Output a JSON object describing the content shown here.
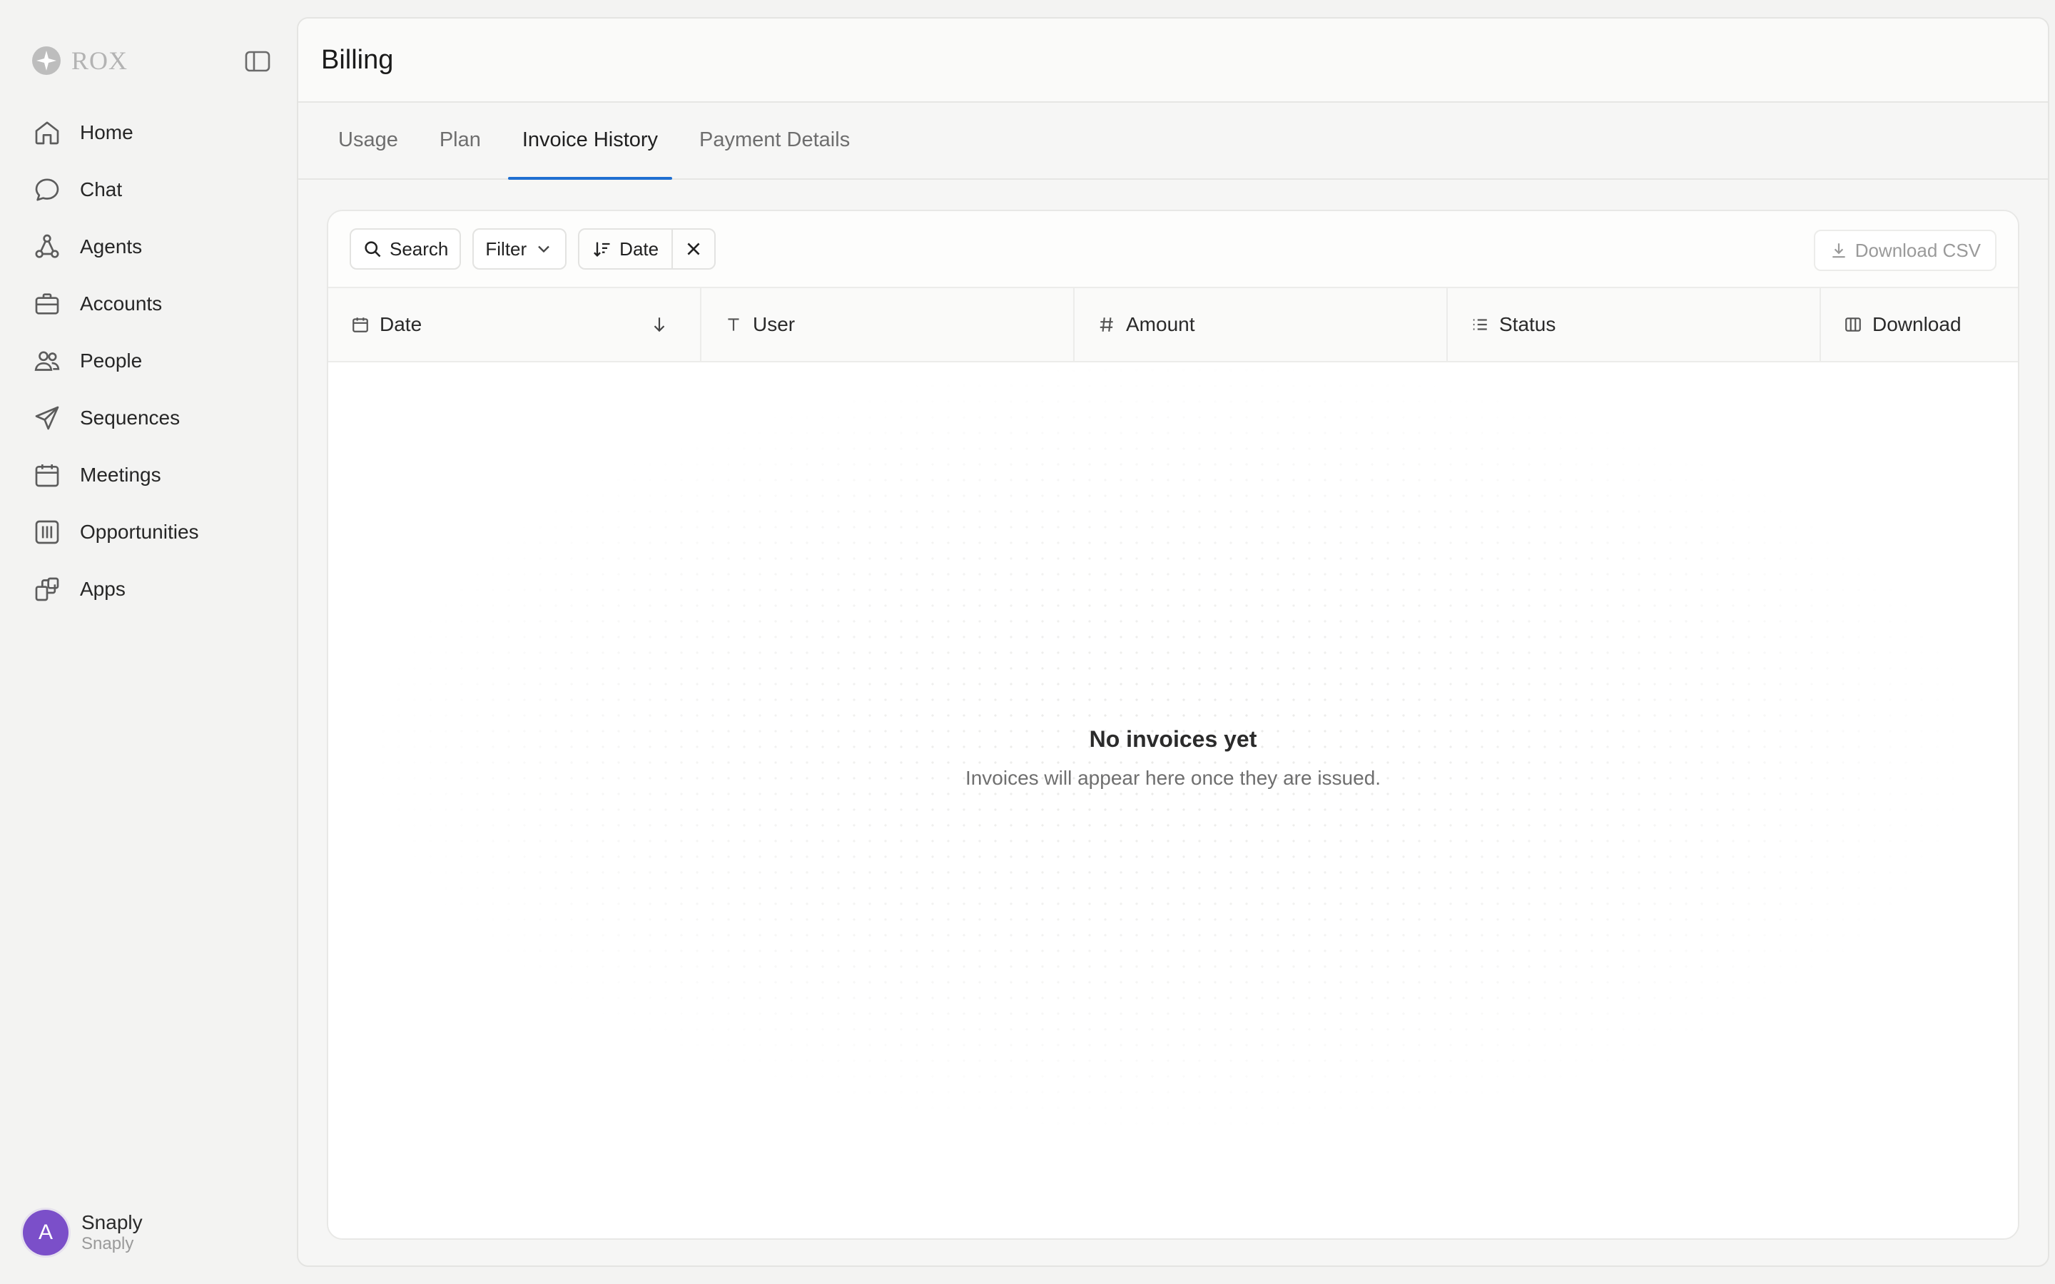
{
  "brand": {
    "name": "ROX"
  },
  "sidebar": {
    "items": [
      {
        "label": "Home",
        "icon": "home-icon"
      },
      {
        "label": "Chat",
        "icon": "chat-icon"
      },
      {
        "label": "Agents",
        "icon": "agents-icon"
      },
      {
        "label": "Accounts",
        "icon": "briefcase-icon"
      },
      {
        "label": "People",
        "icon": "people-icon"
      },
      {
        "label": "Sequences",
        "icon": "send-icon"
      },
      {
        "label": "Meetings",
        "icon": "calendar-icon"
      },
      {
        "label": "Opportunities",
        "icon": "columns-icon"
      },
      {
        "label": "Apps",
        "icon": "apps-icon"
      }
    ]
  },
  "user": {
    "initial": "A",
    "name": "Snaply",
    "org": "Snaply"
  },
  "header": {
    "title": "Billing"
  },
  "tabs": [
    {
      "label": "Usage",
      "active": false
    },
    {
      "label": "Plan",
      "active": false
    },
    {
      "label": "Invoice History",
      "active": true
    },
    {
      "label": "Payment Details",
      "active": false
    }
  ],
  "toolbar": {
    "search_label": "Search",
    "filter_label": "Filter",
    "sort_label": "Date",
    "download_csv_label": "Download CSV"
  },
  "table": {
    "columns": [
      {
        "label": "Date",
        "icon": "calendar-icon"
      },
      {
        "label": "User",
        "icon": "text-icon"
      },
      {
        "label": "Amount",
        "icon": "hash-icon"
      },
      {
        "label": "Status",
        "icon": "list-icon"
      },
      {
        "label": "Download",
        "icon": "columns-icon"
      }
    ],
    "sort": {
      "column": "Date",
      "direction": "desc"
    }
  },
  "empty_state": {
    "title": "No invoices yet",
    "subtitle": "Invoices will appear here once they are issued."
  },
  "colors": {
    "accent": "#1f6fd1",
    "avatar": "#7b4fc9"
  }
}
